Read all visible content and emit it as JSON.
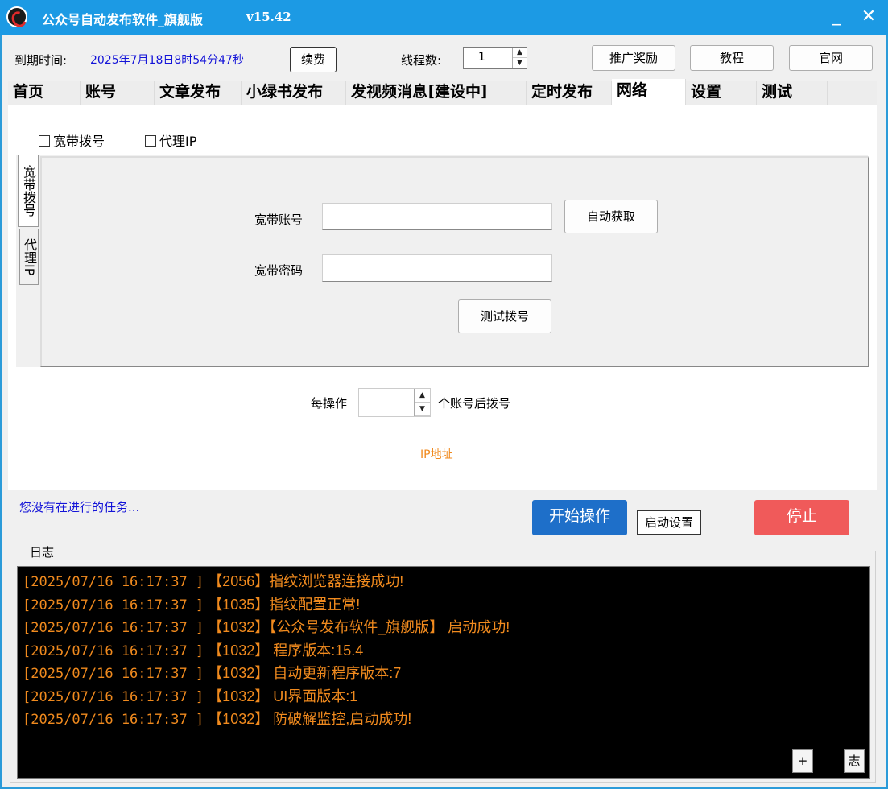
{
  "window": {
    "title": "公众号自动发布软件_旗舰版",
    "version": "v15.42",
    "minimize_glyph": "_",
    "close_glyph": "✕"
  },
  "topbar": {
    "expiry_label": "到期时间:",
    "expiry_value": "2025年7月18日8时54分47秒",
    "renew_button": "续费",
    "threads_label": "线程数:",
    "threads_value": "1",
    "promo_button": "推广奖励",
    "tutorial_button": "教程",
    "website_button": "官网"
  },
  "tabs": [
    "首页",
    "账号",
    "文章发布",
    "小绿书发布",
    "发视频消息[建设中]",
    "定时发布",
    "网络",
    "设置",
    "测试"
  ],
  "active_tab": "网络",
  "network": {
    "dialup_checkbox": "宽带拨号",
    "proxy_checkbox": "代理IP",
    "side_tabs": [
      "宽带拨号",
      "代理IP"
    ],
    "account_label": "宽带账号",
    "account_value": "",
    "password_label": "宽带密码",
    "password_value": "",
    "auto_fetch_button": "自动获取",
    "test_dial_button": "测试拨号",
    "per_operation_label": "每操作",
    "per_operation_value": "",
    "after_accounts_label": "个账号后拨号",
    "ip_label": "IP地址"
  },
  "status": {
    "task_message": "您没有在进行的任务...",
    "start_button": "开始操作",
    "startup_settings_button": "启动设置",
    "stop_button": "停止"
  },
  "log": {
    "title": "日志",
    "lines": [
      {
        "ts": "[2025/07/16 16:17:37 ]",
        "msg": "【2056】指纹浏览器连接成功!"
      },
      {
        "ts": "[2025/07/16 16:17:37 ]",
        "msg": "【1035】指纹配置正常!"
      },
      {
        "ts": "[2025/07/16 16:17:37 ]",
        "msg": "【1032】【公众号发布软件_旗舰版】 启动成功!"
      },
      {
        "ts": "[2025/07/16 16:17:37 ]",
        "msg": "【1032】 程序版本:15.4"
      },
      {
        "ts": "[2025/07/16 16:17:37 ]",
        "msg": "【1032】 自动更新程序版本:7"
      },
      {
        "ts": "[2025/07/16 16:17:37 ]",
        "msg": "【1032】 UI界面版本:1"
      },
      {
        "ts": "[2025/07/16 16:17:37 ]",
        "msg": "【1032】 防破解监控,启动成功!"
      }
    ],
    "plus_button": "+",
    "log_button": "志"
  },
  "colors": {
    "titlebar": "#1c9ae4",
    "start_button": "#1e6fc9",
    "stop_button": "#f05a5a",
    "log_text": "#f08a1e",
    "status_text": "#1414d8",
    "expiry_text": "#1414d8",
    "ip_text": "#f08a1e"
  }
}
